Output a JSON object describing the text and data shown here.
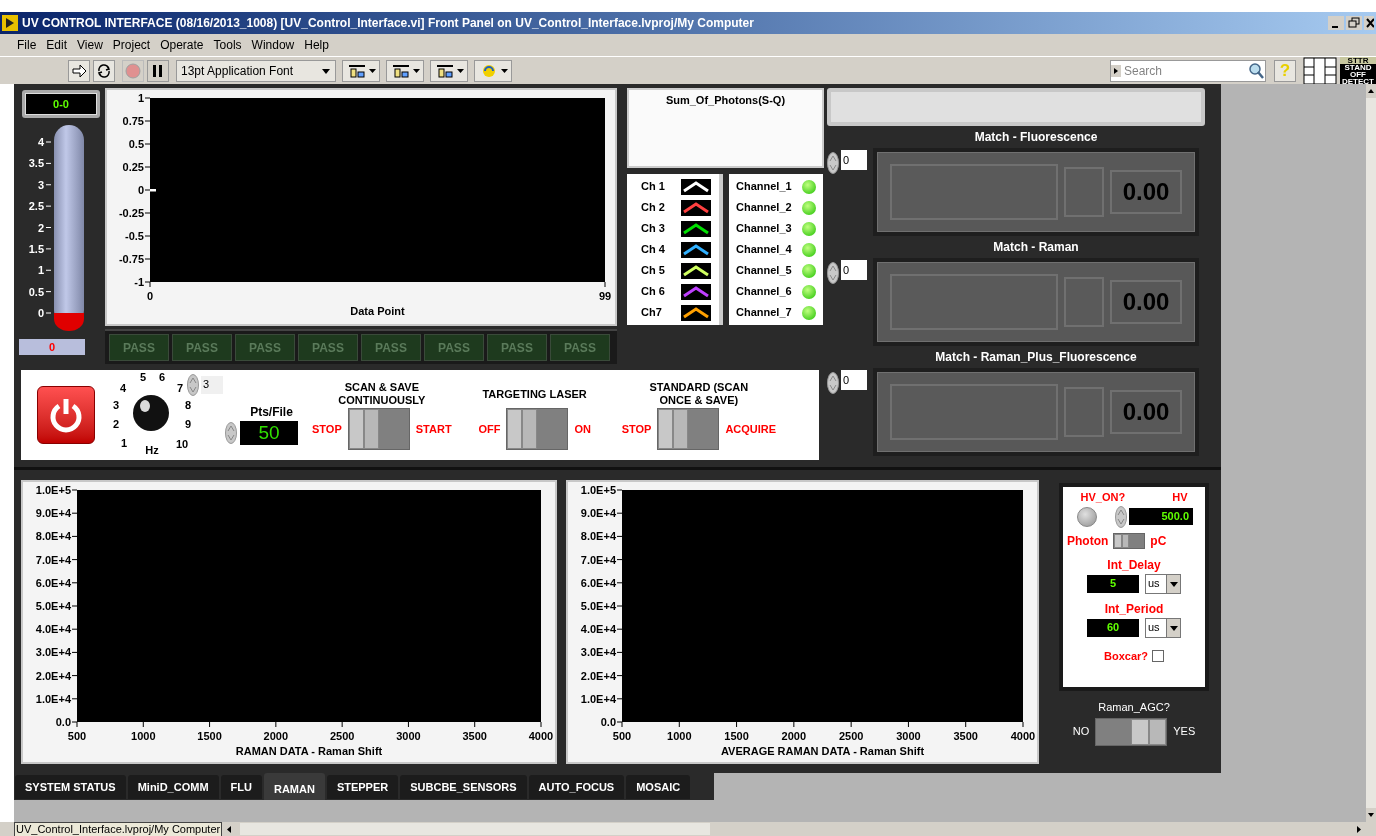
{
  "window": {
    "title": "UV CONTROL INTERFACE (08/16/2013_1008) [UV_Control_Interface.vi] Front Panel on UV_Control_Interface.lvproj/My Computer"
  },
  "menu": [
    "File",
    "Edit",
    "View",
    "Project",
    "Operate",
    "Tools",
    "Window",
    "Help"
  ],
  "toolbar": {
    "font": "13pt Application Font",
    "search_placeholder": "Search",
    "help": "?",
    "badge_top": "STTR",
    "badge_text": "STAND OFF DETECT"
  },
  "display": {
    "value": "0-0"
  },
  "thermometer": {
    "ticks": [
      "4",
      "3.5",
      "3",
      "2.5",
      "2",
      "1.5",
      "1",
      "0.5",
      "0"
    ],
    "value": "0"
  },
  "waveform_chart": {
    "chart_data": {
      "type": "line",
      "xlabel": "Data Point",
      "xticks": [
        0,
        99
      ],
      "yticks": [
        -1,
        -0.75,
        -0.5,
        -0.25,
        0,
        0.25,
        0.5,
        0.75,
        1
      ],
      "xlim": [
        0,
        99
      ],
      "ylim": [
        -1,
        1
      ]
    }
  },
  "pass_indicators": [
    {
      "label": "PASS",
      "on": false
    },
    {
      "label": "PASS",
      "on": false
    },
    {
      "label": "PASS",
      "on": false
    },
    {
      "label": "PASS",
      "on": false
    },
    {
      "label": "PASS",
      "on": false
    },
    {
      "label": "PASS",
      "on": false
    },
    {
      "label": "PASS",
      "on": false
    },
    {
      "label": "PASS",
      "on": false
    }
  ],
  "sum_of_photons": {
    "label": "Sum_Of_Photons(S-Q)"
  },
  "legend": [
    {
      "label": "Ch 1",
      "color": "#ffffff"
    },
    {
      "label": "Ch 2",
      "color": "#ff4040"
    },
    {
      "label": "Ch 3",
      "color": "#00e000"
    },
    {
      "label": "Ch 4",
      "color": "#30b0ff"
    },
    {
      "label": "Ch 5",
      "color": "#d0ff60"
    },
    {
      "label": "Ch 6",
      "color": "#c040ff"
    },
    {
      "label": "Ch7",
      "color": "#ffa000"
    }
  ],
  "channels": [
    {
      "label": "Channel_1",
      "on": true
    },
    {
      "label": "Channel_2",
      "on": true
    },
    {
      "label": "Channel_3",
      "on": true
    },
    {
      "label": "Channel_4",
      "on": true
    },
    {
      "label": "Channel_5",
      "on": true
    },
    {
      "label": "Channel_6",
      "on": true
    },
    {
      "label": "Channel_7",
      "on": true
    }
  ],
  "matches": [
    {
      "title": "Match - Fluorescence",
      "index": "0",
      "value": "0.00"
    },
    {
      "title": "Match - Raman",
      "index": "0",
      "value": "0.00"
    },
    {
      "title": "Match - Raman_Plus_Fluorescence",
      "index": "0",
      "value": "0.00"
    }
  ],
  "controls": {
    "knob_labels": [
      "1",
      "2",
      "3",
      "4",
      "5",
      "6",
      "7",
      "8",
      "9",
      "10"
    ],
    "knob_unit": "Hz",
    "rate": "3",
    "pts_label": "Pts/File",
    "pts_value": "50",
    "switches": [
      {
        "title": "SCAN & SAVE CONTINUOUSLY",
        "off_label": "STOP",
        "on_label": "START",
        "on": false
      },
      {
        "title": "TARGETING LASER",
        "off_label": "OFF",
        "on_label": "ON",
        "on": false
      },
      {
        "title": "STANDARD (SCAN ONCE & SAVE)",
        "off_label": "STOP",
        "on_label": "ACQUIRE",
        "on": false
      }
    ]
  },
  "raman_chart": {
    "chart_data": {
      "type": "line",
      "xlabel": "RAMAN DATA - Raman Shift",
      "xlim": [
        500,
        4000
      ],
      "ylim": [
        0,
        100000
      ],
      "xticks": [
        500,
        1000,
        1500,
        2000,
        2500,
        3000,
        3500,
        4000
      ],
      "yticks": [
        {
          "value": 0,
          "label": "0.0"
        },
        {
          "value": 10000,
          "label": "1.0E+4"
        },
        {
          "value": 20000,
          "label": "2.0E+4"
        },
        {
          "value": 30000,
          "label": "3.0E+4"
        },
        {
          "value": 40000,
          "label": "4.0E+4"
        },
        {
          "value": 50000,
          "label": "5.0E+4"
        },
        {
          "value": 60000,
          "label": "6.0E+4"
        },
        {
          "value": 70000,
          "label": "7.0E+4"
        },
        {
          "value": 80000,
          "label": "8.0E+4"
        },
        {
          "value": 90000,
          "label": "9.0E+4"
        },
        {
          "value": 100000,
          "label": "1.0E+5"
        }
      ]
    }
  },
  "average_chart": {
    "chart_data": {
      "type": "line",
      "xlabel": "AVERAGE RAMAN DATA - Raman Shift",
      "xlim": [
        500,
        4000
      ],
      "ylim": [
        0,
        100000
      ],
      "xticks": [
        500,
        1000,
        1500,
        2000,
        2500,
        3000,
        3500,
        4000
      ],
      "yticks": [
        {
          "value": 0,
          "label": "0.0"
        },
        {
          "value": 10000,
          "label": "1.0E+4"
        },
        {
          "value": 20000,
          "label": "2.0E+4"
        },
        {
          "value": 30000,
          "label": "3.0E+4"
        },
        {
          "value": 40000,
          "label": "4.0E+4"
        },
        {
          "value": 50000,
          "label": "5.0E+4"
        },
        {
          "value": 60000,
          "label": "6.0E+4"
        },
        {
          "value": 70000,
          "label": "7.0E+4"
        },
        {
          "value": 80000,
          "label": "8.0E+4"
        },
        {
          "value": 90000,
          "label": "9.0E+4"
        },
        {
          "value": 100000,
          "label": "1.0E+5"
        }
      ]
    }
  },
  "hv_panel": {
    "hv_on_label": "HV_ON?",
    "hv_on": false,
    "hv_label": "HV",
    "hv_value": "500.0",
    "photon_label": "Photon",
    "pc_label": "pC",
    "photon_switch_on": false,
    "int_delay": {
      "label": "Int_Delay",
      "value": "5",
      "unit": "us"
    },
    "int_period": {
      "label": "Int_Period",
      "value": "60",
      "unit": "us"
    },
    "boxcar": {
      "label": "Boxcar?",
      "checked": false
    }
  },
  "raman_agc": {
    "label": "Raman_AGC?",
    "off_label": "NO",
    "on_label": "YES",
    "on": true
  },
  "tabs": [
    {
      "label": "SYSTEM STATUS",
      "selected": false
    },
    {
      "label": "MiniD_COMM",
      "selected": false
    },
    {
      "label": "FLU",
      "selected": false
    },
    {
      "label": "RAMAN",
      "selected": true
    },
    {
      "label": "STEPPER",
      "selected": false
    },
    {
      "label": "SUBCBE_SENSORS",
      "selected": false
    },
    {
      "label": "AUTO_FOCUS",
      "selected": false
    },
    {
      "label": "MOSAIC",
      "selected": false
    }
  ],
  "status_bar": {
    "path": "UV_Control_Interface.lvproj/My Computer"
  }
}
